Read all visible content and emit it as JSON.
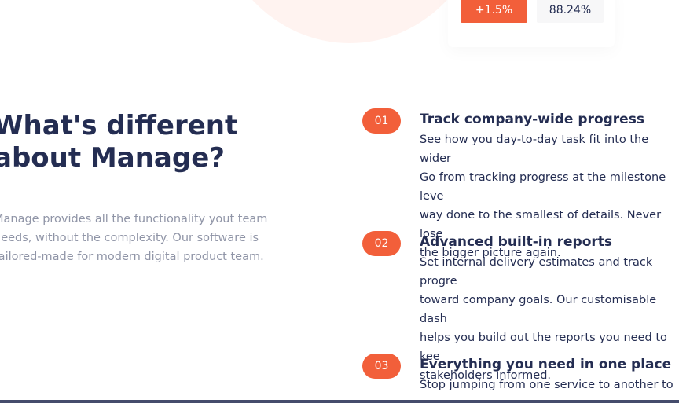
{
  "hero_stats": {
    "growth_label": "+1.5%",
    "percentage_label": "88.24%"
  },
  "section": {
    "heading": "What's different about Manage?",
    "intro": "Manage provides all the functionality yout team needs, without the complexity. Our software is tailored-made for modern digital product team."
  },
  "features": [
    {
      "number": "01",
      "title": "Track company-wide progress",
      "description": "See how you day-to-day task fit into the wider\nGo from tracking progress at the milestone leve\nway done to the smallest of details. Never lose\nthe bigger picture again."
    },
    {
      "number": "02",
      "title": "Advanced built-in reports",
      "description": "Set internal delivery estimates and track progre\ntoward company goals. Our customisable dash\nhelps you build out the reports you need to kee\nstakeholders informed."
    },
    {
      "number": "03",
      "title": "Everything you need in one place",
      "description": "Stop jumping from one service to another to"
    }
  ],
  "colors": {
    "accent": "#f25f3a",
    "heading": "#242d52",
    "muted": "#9095a7"
  }
}
